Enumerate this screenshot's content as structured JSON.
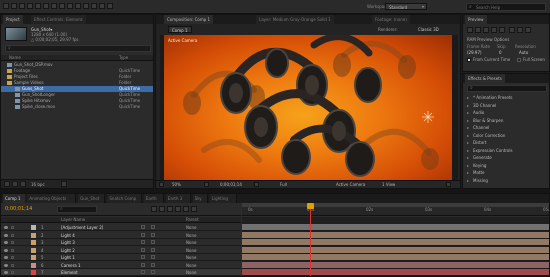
{
  "toolbar": {
    "workspace_label": "Workspace:",
    "workspace_value": "Standard",
    "search_placeholder": "Search Help"
  },
  "project": {
    "tab": "Project",
    "effect_tab": "Effect Controls: Element",
    "file_name": "Gun_Shot▾",
    "file_info": "1280 x 640 (1.00)",
    "file_duration": "△ 0;00;02;05, 29.97 fps",
    "col_name": "Name",
    "col_type": "Type",
    "items": [
      {
        "name": "Gun_Shot_DSP.mov",
        "type": "",
        "indent": 0,
        "kind": "file"
      },
      {
        "name": "Footage",
        "type": "QuickTime",
        "indent": 0,
        "kind": "folder"
      },
      {
        "name": "Project Files",
        "type": "Folder",
        "indent": 0,
        "kind": "folder"
      },
      {
        "name": "Sample Videos",
        "type": "Folder",
        "indent": 0,
        "kind": "folder"
      },
      {
        "name": "Guns_Shot",
        "type": "QuickTime",
        "indent": 1,
        "kind": "file",
        "selected": true
      },
      {
        "name": "Gun_ShotLonger",
        "type": "QuickTime",
        "indent": 1,
        "kind": "file"
      },
      {
        "name": "Spike Hitsmov",
        "type": "QuickTime",
        "indent": 1,
        "kind": "file"
      },
      {
        "name": "Spike_close.mov",
        "type": "QuickTime",
        "indent": 1,
        "kind": "file"
      }
    ],
    "footer_bpc": "16 bpc"
  },
  "composition": {
    "tab": "Composition: Comp 1",
    "layer_tab": "Layer: Medium Gray-Orange Solid 1",
    "footage_tab": "Footage: (none)",
    "subtab": "Comp 1",
    "renderer_label": "Renderer:",
    "renderer_value": "Classic 3D",
    "camera_label": "Active Camera",
    "zoom": "50%",
    "timecode": "0;00;01;14",
    "resolution": "Full",
    "view_camera": "Active Camera",
    "views": "1 View"
  },
  "preview": {
    "tab": "Preview",
    "ram_options": "RAM Preview Options",
    "frame_rate_label": "Frame Rate",
    "skip_label": "Skip",
    "resolution_label": "Resolution",
    "frame_rate": "(29.97)",
    "skip": "0",
    "resolution": "Auto",
    "from_current": "From Current Time",
    "full_screen": "Full Screen"
  },
  "effects": {
    "tab": "Effects & Presets",
    "search_placeholder": "ρ•",
    "items": [
      "* Animation Presets",
      "3D Channel",
      "Audio",
      "Blur & Sharpen",
      "Channel",
      "Color Correction",
      "Distort",
      "Expression Controls",
      "Generate",
      "Keying",
      "Matte",
      "Missing"
    ]
  },
  "timeline": {
    "tabs": [
      "Comp 1",
      "Animating Objects",
      "Gun_Shot",
      "Snatch Comp",
      "Earth",
      "Earth 3",
      "Sky",
      "Lighting"
    ],
    "timecode": "0;00;01;14",
    "col_layer": "Layer Name",
    "col_parent": "Parent",
    "parent_value": "None",
    "ruler": [
      "0s",
      "01s",
      "02s",
      "03s",
      "04s",
      "05s"
    ],
    "playhead_fraction": 0.22,
    "layers": [
      {
        "num": "1",
        "name": "[Adjustment Layer 2]",
        "color": "#b6b6b6",
        "bar": "#8d8d8d"
      },
      {
        "num": "2",
        "name": "Light 4",
        "color": "#c9a070",
        "bar": "#b8977c"
      },
      {
        "num": "3",
        "name": "Light 3",
        "color": "#c9a070",
        "bar": "#b8977c"
      },
      {
        "num": "4",
        "name": "Light 2",
        "color": "#c9a070",
        "bar": "#b8977c"
      },
      {
        "num": "5",
        "name": "Light 1",
        "color": "#c9a070",
        "bar": "#b8977c"
      },
      {
        "num": "6",
        "name": "Camera 1",
        "color": "#c98e8e",
        "bar": "#b27a7a"
      },
      {
        "num": "7",
        "name": "Element",
        "color": "#d44",
        "bar": "#c85a5a"
      }
    ]
  },
  "colors": {
    "accent": "#e0a000",
    "orange_bg": "#e85a0a",
    "selection": "#3d6ba6"
  }
}
